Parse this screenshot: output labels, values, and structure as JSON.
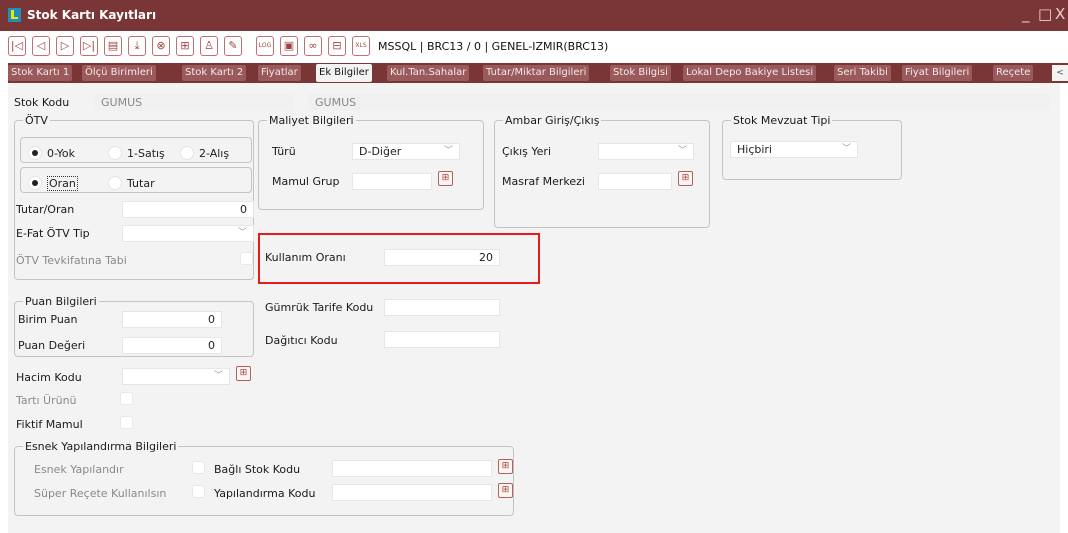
{
  "window": {
    "title": "Stok Kartı Kayıtları",
    "controls": [
      "_",
      "□",
      "X"
    ]
  },
  "toolbar": {
    "icons": [
      "first-record-icon",
      "prev-record-icon",
      "next-record-icon",
      "last-record-icon",
      "list-icon",
      "download-icon",
      "cancel-icon",
      "add-icon",
      "user-icon",
      "edit-icon",
      "log-icon",
      "document-icon",
      "link-icon",
      "calculator-icon",
      "excel-icon"
    ],
    "glyphs": [
      "|◁",
      "◁",
      "▷",
      "▷|",
      "▤",
      "⤓",
      "⊗",
      "⊞",
      "♙",
      "✎",
      "LOG",
      "▣",
      "∞",
      "⊟",
      "XLS"
    ],
    "connection_info": "MSSQL | BRC13 / 0 | GENEL-IZMIR(BRC13)"
  },
  "tabs": [
    "Stok Kartı 1",
    "Ölçü Birimleri",
    "Stok Kartı 2",
    "Fiyatlar",
    "Ek Bilgiler",
    "Kul.Tan.Sahalar",
    "Tutar/Miktar Bilgileri",
    "Stok Bilgisi",
    "Lokal Depo Bakiye Listesi",
    "Seri Takibi",
    "Fiyat Bilgileri",
    "Reçete"
  ],
  "active_tab": "Ek Bilgiler",
  "tab_scroll": "< >",
  "form": {
    "stok_kodu_label": "Stok Kodu",
    "stok_kodu_value": "GUMUS",
    "stok_adi_value": "GUMUS",
    "otv": {
      "title": "ÖTV",
      "options1": [
        "0-Yok",
        "1-Satış",
        "2-Alış"
      ],
      "selected1": "0-Yok",
      "options2": [
        "Oran",
        "Tutar"
      ],
      "selected2": "Oran",
      "tutar_oran_label": "Tutar/Oran",
      "tutar_oran_value": "0",
      "efat_label": "E-Fat ÖTV Tip",
      "efat_value": "",
      "tevkifat_label": "ÖTV Tevkifatına Tabi"
    },
    "maliyet": {
      "title": "Maliyet Bilgileri",
      "turu_label": "Türü",
      "turu_value": "D-Diğer",
      "mamul_grup_label": "Mamul Grup",
      "mamul_grup_value": ""
    },
    "ambar": {
      "title": "Ambar Giriş/Çıkış",
      "cikis_yeri_label": "Çıkış Yeri",
      "cikis_yeri_value": "",
      "masraf_label": "Masraf Merkezi",
      "masraf_value": ""
    },
    "mevzuat": {
      "title": "Stok Mevzuat Tipi",
      "value": "Hiçbiri"
    },
    "kullanim_orani_label": "Kullanım Oranı",
    "kullanim_orani_value": "20",
    "puan": {
      "title": "Puan Bilgileri",
      "birim_puan_label": "Birim Puan",
      "birim_puan_value": "0",
      "puan_degeri_label": "Puan Değeri",
      "puan_degeri_value": "0"
    },
    "gumruk_label": "Gümrük Tarife Kodu",
    "gumruk_value": "",
    "dagitici_label": "Dağıtıcı Kodu",
    "dagitici_value": "",
    "hacim_label": "Hacim Kodu",
    "hacim_value": "",
    "tarti_label": "Tartı Ürünü",
    "fiktif_label": "Fiktif Mamul",
    "esnek": {
      "title": "Esnek Yapılandırma Bilgileri",
      "esnek_label": "Esnek Yapılandır",
      "super_recete_label": "Süper Reçete Kullanılsın",
      "bagli_stok_label": "Bağlı Stok Kodu",
      "bagli_stok_value": "",
      "yapilandirma_label": "Yapılandırma Kodu",
      "yapilandirma_value": ""
    }
  },
  "colors": {
    "titlebar": "#7a3536",
    "tab_inactive": "#9a5a5b",
    "panel": "#f3f3f3",
    "highlight": "#e21b1b"
  }
}
